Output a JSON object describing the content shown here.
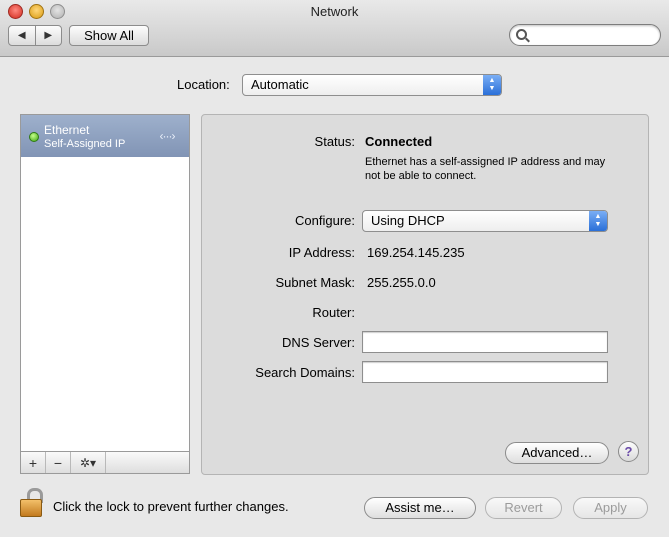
{
  "window": {
    "title": "Network"
  },
  "toolbar": {
    "back_label": "◀",
    "forward_label": "▶",
    "show_all_label": "Show All",
    "search_placeholder": ""
  },
  "location": {
    "label": "Location:",
    "value": "Automatic"
  },
  "sidebar": {
    "services": [
      {
        "name": "Ethernet",
        "status": "Self-Assigned IP",
        "status_color": "#3ea612"
      }
    ],
    "add_label": "+",
    "remove_label": "−",
    "action_label": "✲▾"
  },
  "panel": {
    "status_label": "Status:",
    "status_value": "Connected",
    "status_desc": "Ethernet has a self-assigned IP address and may not be able to connect.",
    "configure_label": "Configure:",
    "configure_value": "Using DHCP",
    "ip_label": "IP Address:",
    "ip_value": "169.254.145.235",
    "subnet_label": "Subnet Mask:",
    "subnet_value": "255.255.0.0",
    "router_label": "Router:",
    "router_value": "",
    "dns_label": "DNS Server:",
    "dns_value": "",
    "search_domains_label": "Search Domains:",
    "search_domains_value": "",
    "advanced_label": "Advanced…",
    "help_label": "?"
  },
  "footer": {
    "lock_text": "Click the lock to prevent further changes.",
    "assist_label": "Assist me…",
    "revert_label": "Revert",
    "apply_label": "Apply"
  },
  "colors": {
    "accent": "#2a6fd8",
    "selection": "#8194b5"
  }
}
